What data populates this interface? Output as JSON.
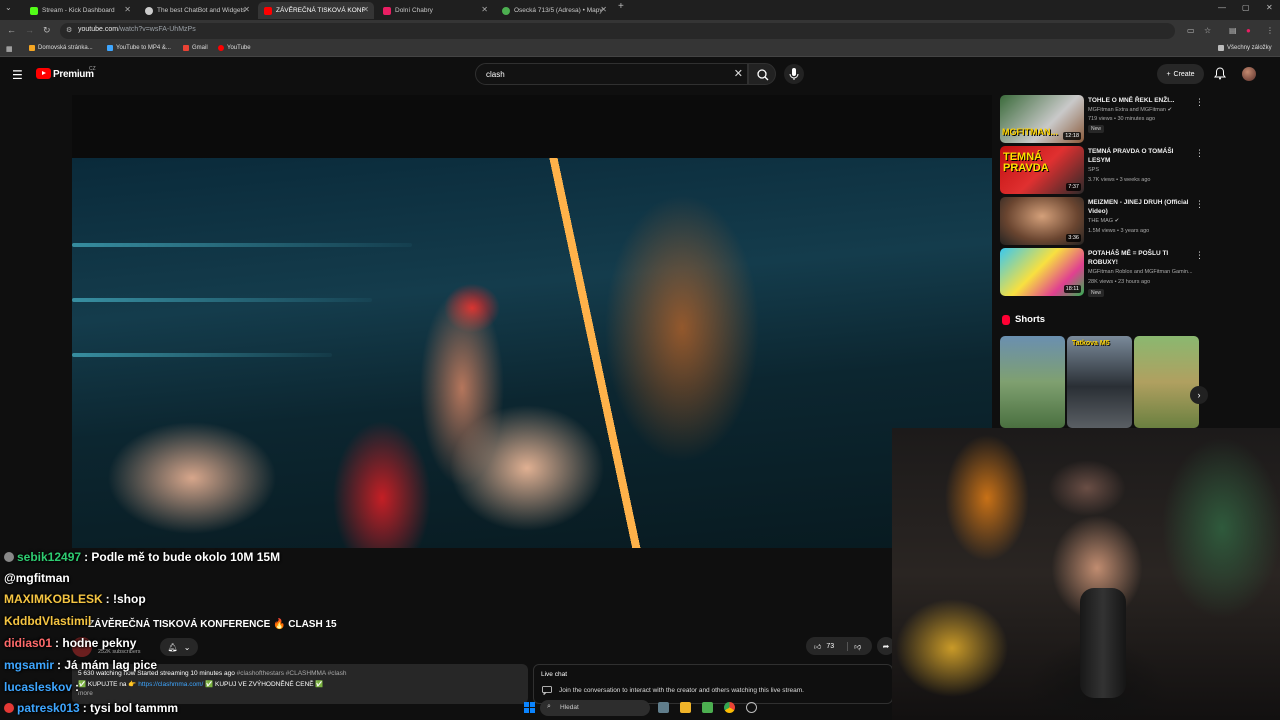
{
  "browser": {
    "tabs": [
      {
        "label": "Stream - Kick Dashboard",
        "color": "#53fc18",
        "active": false
      },
      {
        "label": "The best ChatBot and Widgets",
        "color": "#cccccc",
        "active": false
      },
      {
        "label": "ZÁVĚREČNÁ TISKOVÁ KONF",
        "color": "#ff0000",
        "active": true
      },
      {
        "label": "Dolní Chabry",
        "color": "#e91e63",
        "active": false
      },
      {
        "label": "Osecká 713/5 (Adresa) • Mapy",
        "color": "#4caf50",
        "active": false
      }
    ],
    "url_host": "youtube.com",
    "url_path": "/watch?v=wsFA-UhMzPs",
    "bookmarks": [
      "Domovská stránka...",
      "YouTube to MP4 &...",
      "Gmail",
      "YouTube"
    ],
    "all_bookmarks": "Všechny záložky"
  },
  "yt": {
    "brand": "Premium",
    "country": "CZ",
    "search_value": "clash",
    "create_label": "Create"
  },
  "video": {
    "title": "ZÁVĚREČNÁ TISKOVÁ KONFERENCE 🔥 CLASH 15",
    "subscribers": "252K subscribers",
    "likes": "73",
    "description_line1": "5 630 watching now  Started streaming 10 minutes ago",
    "description_tags": "#clashofthestars #CLASHMMA #clash",
    "description_line2a": "✅ KUPUJTE na 👉",
    "description_link": "https://clashmma.com/",
    "description_line2b": "✅ KUPUJ VE ZVÝHODNĚNÉ CENĚ ✅",
    "description_more": "more",
    "live_chat_title": "Live chat",
    "live_chat_join": "Join the conversation to interact with the creator and others watching this live stream."
  },
  "sidebar": {
    "recommendations": [
      {
        "title": "TOHLE O MNĚ ŘEKL ENŽI...",
        "channel": "MGFitman Extra and MGFitman",
        "meta": "719 views • 30 minutes ago",
        "badge": "New",
        "duration": "12:18"
      },
      {
        "title": "TEMNÁ PRAVDA O TOMÁŠI LESYM",
        "channel": "SPS",
        "meta": "3.7K views • 3 weeks ago",
        "badge": "",
        "duration": "7:37"
      },
      {
        "title": "MEIZMEN - JINEJ DRUH (Official Video)",
        "channel": "THE MAG",
        "meta": "1.5M views • 3 years ago",
        "badge": "",
        "duration": "3:36"
      },
      {
        "title": "POTAHÁŠ MĚ = POŠLU TI ROBUXY!",
        "channel": "MGFitman Roblox and MGFitman Gamin...",
        "meta": "28K views • 23 hours ago",
        "badge": "New",
        "duration": "18:11"
      }
    ],
    "shorts_label": "Shorts",
    "shorts_overlay_text": [
      "",
      "Tatkova M5",
      ""
    ]
  },
  "chat": [
    {
      "user": "sebik12497",
      "message": ": Podle mě to bude okolo 10M 15M",
      "color": "#2ecc71"
    },
    {
      "user": "",
      "message": "@mgfitman",
      "color": "#ffffff"
    },
    {
      "user": "MAXIMKOBLESK",
      "message": ": !shop",
      "color": "#f5c542"
    },
    {
      "user": "KddbdVlastimil",
      "message": "",
      "color": "#f5c542"
    },
    {
      "user": "didias01",
      "message": ": hodne pekny",
      "color": "#ff6b6b"
    },
    {
      "user": "mgsamir",
      "message": ": Já mám lag pice",
      "color": "#3ea6ff"
    },
    {
      "user": "lucasleskov",
      "message": ":",
      "color": "#3ea6ff"
    },
    {
      "user": "patresk013",
      "message": ": tysi bol tammm",
      "color": "#3ea6ff"
    }
  ],
  "taskbar": {
    "search_placeholder": "Hledat"
  }
}
